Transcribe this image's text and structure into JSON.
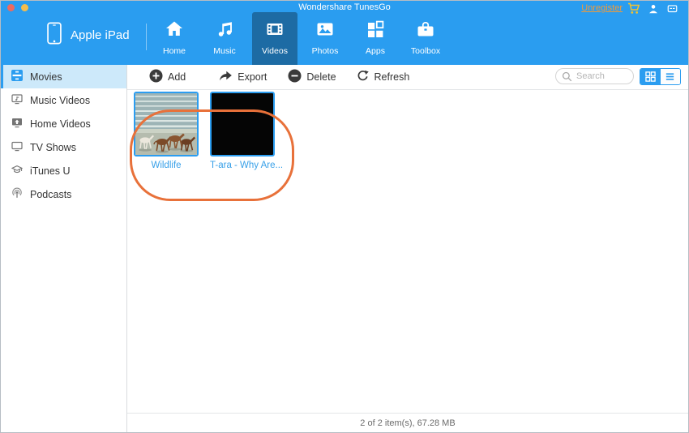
{
  "titlebar": {
    "title": "Wondershare TunesGo",
    "unregister_label": "Unregister"
  },
  "device": {
    "name": "Apple iPad"
  },
  "nav_tabs": [
    {
      "label": "Home",
      "icon": "home-icon",
      "selected": false
    },
    {
      "label": "Music",
      "icon": "music-icon",
      "selected": false
    },
    {
      "label": "Videos",
      "icon": "videos-icon",
      "selected": true
    },
    {
      "label": "Photos",
      "icon": "photos-icon",
      "selected": false
    },
    {
      "label": "Apps",
      "icon": "apps-icon",
      "selected": false
    },
    {
      "label": "Toolbox",
      "icon": "toolbox-icon",
      "selected": false
    }
  ],
  "toolbar": {
    "buttons": [
      {
        "label": "Add",
        "icon": "add-icon"
      },
      {
        "label": "Export",
        "icon": "export-icon"
      },
      {
        "label": "Delete",
        "icon": "delete-icon"
      },
      {
        "label": "Refresh",
        "icon": "refresh-icon"
      }
    ],
    "search_placeholder": "Search",
    "view_modes": [
      "grid",
      "list"
    ],
    "active_view": "grid"
  },
  "sidebar": {
    "items": [
      {
        "label": "Movies",
        "icon": "movies-icon",
        "selected": true
      },
      {
        "label": "Music Videos",
        "icon": "music-videos-icon",
        "selected": false
      },
      {
        "label": "Home Videos",
        "icon": "home-videos-icon",
        "selected": false
      },
      {
        "label": "TV Shows",
        "icon": "tv-shows-icon",
        "selected": false
      },
      {
        "label": "iTunes U",
        "icon": "itunes-u-icon",
        "selected": false
      },
      {
        "label": "Podcasts",
        "icon": "podcasts-icon",
        "selected": false
      }
    ]
  },
  "content": {
    "videos": [
      {
        "title": "Wildlife",
        "thumb": "horses-on-beach",
        "selected": true
      },
      {
        "title": "T-ara - Why Are...",
        "thumb": "black-frame",
        "selected": true
      }
    ],
    "annotation": "orange-highlight-ring"
  },
  "statusbar": {
    "summary": "2 of 2 item(s), 67.28 MB"
  },
  "colors": {
    "header_blue": "#2a9df0",
    "selected_tab_blue": "#1d6ba4",
    "accent_blue": "#2b9df0",
    "sidebar_selected_bg": "#cde9fa",
    "unregister_orange": "#f29a38",
    "annotation_orange": "#e8713a",
    "cart_yellow": "#f2c230"
  }
}
